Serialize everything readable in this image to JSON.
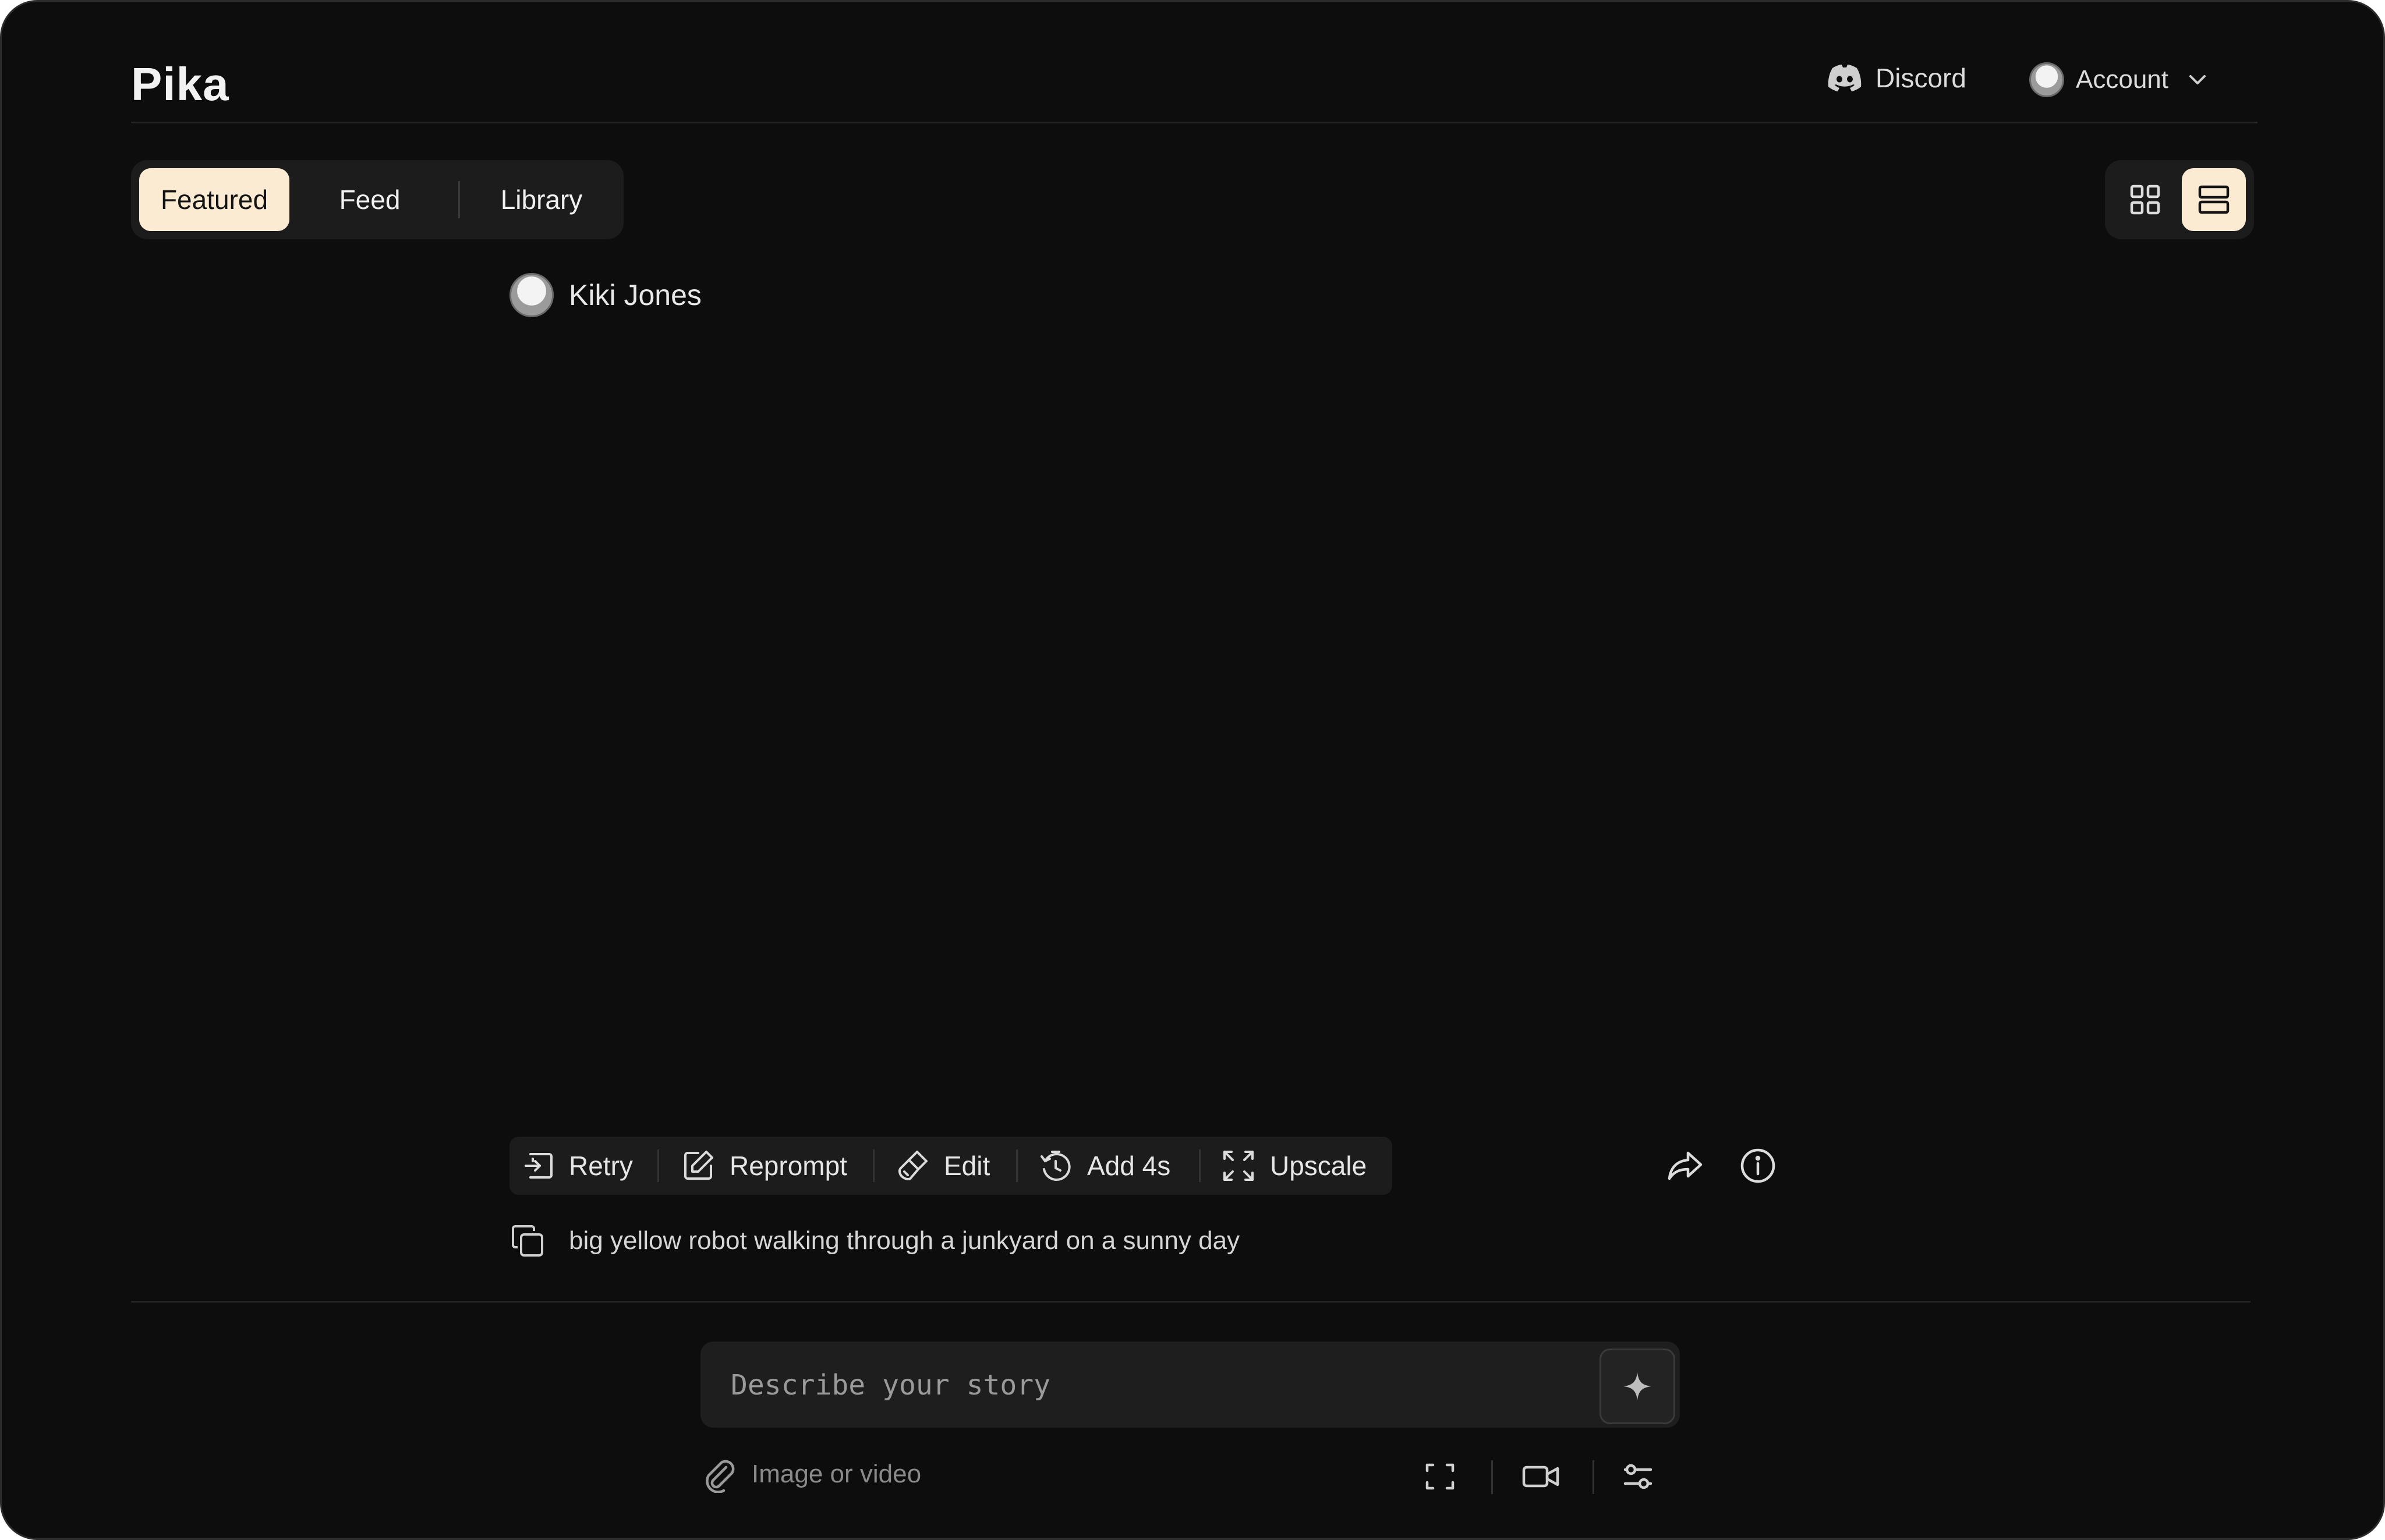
{
  "header": {
    "logo": "Pika",
    "discord_label": "Discord",
    "account_label": "Account"
  },
  "tabs": [
    {
      "label": "Featured",
      "active": true
    },
    {
      "label": "Feed",
      "active": false
    },
    {
      "label": "Library",
      "active": false
    }
  ],
  "view_toggle": {
    "active": "list"
  },
  "post": {
    "author": "Kiki Jones",
    "prompt": "big yellow robot walking through a junkyard on a sunny day"
  },
  "actions": {
    "retry": "Retry",
    "reprompt": "Reprompt",
    "edit": "Edit",
    "add": "Add 4s",
    "upscale": "Upscale"
  },
  "composer": {
    "placeholder": "Describe your story",
    "attach_label": "Image or video"
  },
  "colors": {
    "background": "#0d0d0d",
    "panel": "#1c1c1c",
    "accent": "#fcebd3"
  },
  "icons": [
    "discord-icon",
    "avatar",
    "chevron-down-icon",
    "grid-icon",
    "list-icon",
    "retry-icon",
    "reprompt-icon",
    "edit-icon",
    "add-time-icon",
    "upscale-icon",
    "share-icon",
    "info-icon",
    "copy-icon",
    "sparkle-icon",
    "paperclip-icon",
    "aspect-ratio-icon",
    "video-camera-icon",
    "settings-sliders-icon"
  ]
}
